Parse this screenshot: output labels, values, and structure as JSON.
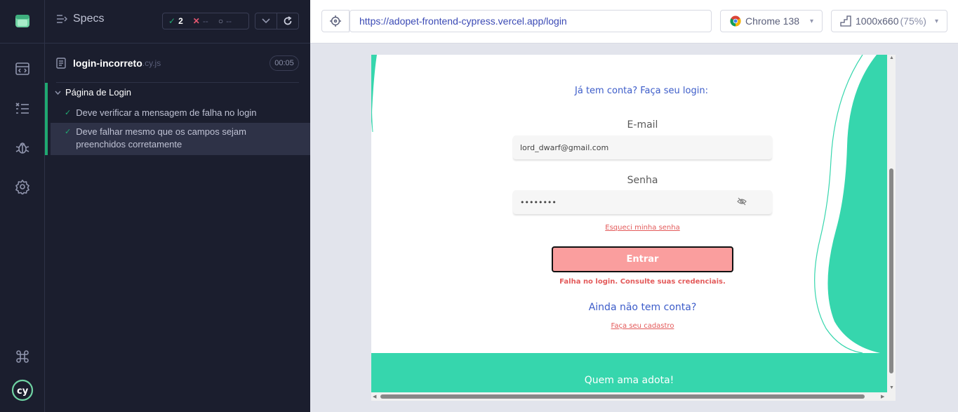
{
  "rail": {
    "icons": [
      "cypress-app-icon",
      "runs-icon",
      "specs-list-icon",
      "debug-icon",
      "settings-icon",
      "keyboard-shortcuts-icon",
      "cypress-logo-icon"
    ]
  },
  "specs": {
    "title": "Specs",
    "passed": "2",
    "failed": "--",
    "pending": "--",
    "file_name": "login-incorreto",
    "file_ext": ".cy.js",
    "duration": "00:05",
    "suite_title": "Página de Login",
    "tests": [
      {
        "label": "Deve verificar a mensagem de falha no login",
        "state": "passed"
      },
      {
        "label": "Deve falhar mesmo que os campos sejam preenchidos corretamente",
        "state": "passed"
      }
    ]
  },
  "toolbar": {
    "url": "https://adopet-frontend-cypress.vercel.app/login",
    "browser": "Chrome 138",
    "viewport": "1000x660",
    "zoom": "(75%)"
  },
  "app": {
    "heading": "Já tem conta? Faça seu login:",
    "email_label": "E-mail",
    "email_value": "lord_dwarf@gmail.com",
    "password_label": "Senha",
    "password_value": "••••••••",
    "forgot_link": "Esqueci minha senha",
    "submit_label": "Entrar",
    "error_message": "Falha no login. Consulte suas credenciais.",
    "no_account": "Ainda não tem conta?",
    "signup_link": "Faça seu cadastro",
    "footer_text": "Quem ama adota!"
  },
  "colors": {
    "sidebar_bg": "#1b1e2e",
    "pass_green": "#1fa971",
    "fail_red": "#e45770",
    "brand_teal": "#36d6ad",
    "button_pink": "#fa9e9e",
    "link_blue": "#3c5cc9",
    "error_red": "#e35a5a"
  }
}
